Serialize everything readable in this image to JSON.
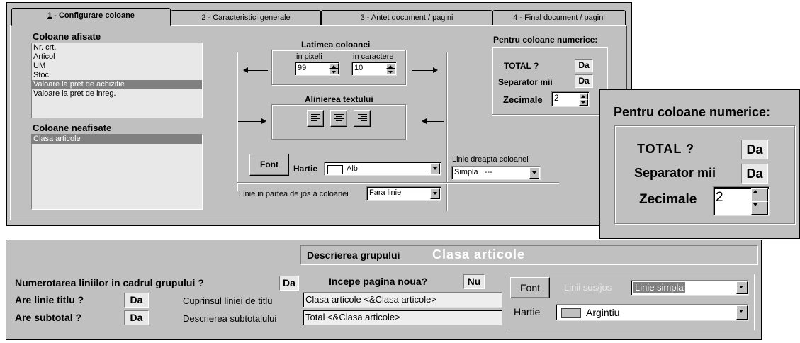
{
  "tabs": [
    {
      "num": "1",
      "label": " - Configurare coloane"
    },
    {
      "num": "2",
      "label": " - Caracteristici generale"
    },
    {
      "num": "3",
      "label": " - Antet document / pagini"
    },
    {
      "num": "4",
      "label": " - Final document / pagini"
    }
  ],
  "shown_columns": {
    "title": "Coloane afisate",
    "items": [
      "Nr. crt.",
      "Articol",
      "UM",
      "Stoc",
      "Valoare la pret de achizitie",
      "Valoare la pret de inreg."
    ],
    "selected_index": 4
  },
  "hidden_columns": {
    "title": "Coloane neafisate",
    "items": [
      "Clasa articole"
    ],
    "selected_index": 0
  },
  "width": {
    "title": "Latimea coloanei",
    "pixels_label": "in pixeli",
    "pixels_value": "99",
    "chars_label": "in caractere",
    "chars_value": "10"
  },
  "alignment": {
    "title": "Alinierea textului"
  },
  "font_button": "Font",
  "paper_label": "Hartie",
  "paper_value": "Alb",
  "right_line": {
    "label": "Linie dreapta coloanei",
    "value": "Simpla   ---"
  },
  "bottom_line": {
    "label": "Linie in partea de jos a coloanei",
    "value": "Fara linie"
  },
  "numeric": {
    "title": "Pentru coloane numerice:",
    "total_label": "TOTAL ?",
    "total_value": "Da",
    "sep_label": "Separator mii",
    "sep_value": "Da",
    "dec_label": "Zecimale",
    "dec_value": "2"
  },
  "group": {
    "desc_label": "Descrierea grupului",
    "desc_value": "Clasa articole",
    "numbering_label": "Numerotarea liniilor in cadrul grupului ?",
    "numbering_value": "Da",
    "newpage_label": "Incepe pagina noua?",
    "newpage_value": "Nu",
    "title_line_label": "Are linie titlu ?",
    "title_line_value": "Da",
    "title_content_label": "Cuprinsul liniei de titlu",
    "title_content_value": "Clasa articole <&Clasa articole>",
    "subtotal_label": "Are subtotal ?",
    "subtotal_value": "Da",
    "subtotal_desc_label": "Descrierea subtotalului",
    "subtotal_desc_value": "Total <&Clasa articole>",
    "font_button": "Font",
    "lines_label": "Linii sus/jos",
    "lines_value": "Linie simpla",
    "paper_label": "Hartie",
    "paper_value": "Argintiu"
  },
  "colors": {
    "selection": "#808080",
    "window": "#c0c0c0",
    "paper_swatch_silver": "#c0c0c0"
  }
}
